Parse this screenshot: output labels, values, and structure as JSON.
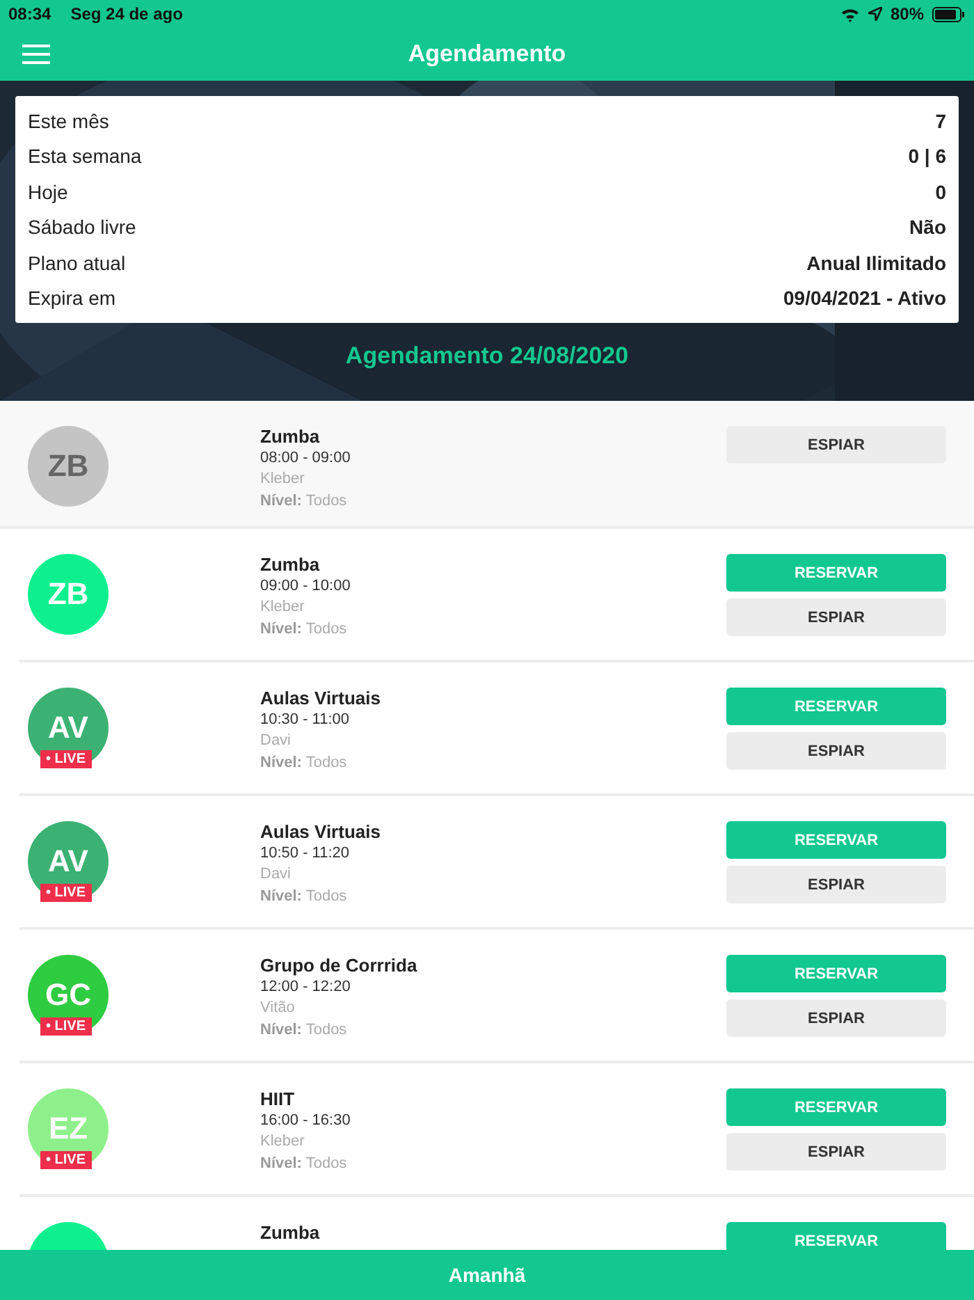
{
  "status_bar": {
    "time": "08:34",
    "date": "Seg 24 de ago",
    "battery": "80%"
  },
  "nav": {
    "title": "Agendamento"
  },
  "stats": [
    {
      "label": "Este mês",
      "value": "7"
    },
    {
      "label": "Esta semana",
      "value": "0 | 6"
    },
    {
      "label": "Hoje",
      "value": "0"
    },
    {
      "label": "Sábado livre",
      "value": "Não"
    },
    {
      "label": "Plano atual",
      "value": "Anual Ilimitado"
    },
    {
      "label": "Expira em",
      "value": "09/04/2021 - Ativo"
    }
  ],
  "heading": "Agendamento 24/08/2020",
  "classes": [
    {
      "initials": "ZB",
      "color": "#c4c4c4",
      "past": true,
      "live": false,
      "name": "Zumba",
      "time": "08:00 - 09:00",
      "instructor": "Kleber",
      "level_label": "Nível:",
      "level_value": "Todos",
      "buttons": [
        {
          "kind": "secondary",
          "label": "ESPIAR"
        }
      ]
    },
    {
      "initials": "ZB",
      "color": "#0ef08f",
      "past": false,
      "live": false,
      "name": "Zumba",
      "time": "09:00 - 10:00",
      "instructor": "Kleber",
      "level_label": "Nível:",
      "level_value": "Todos",
      "buttons": [
        {
          "kind": "primary",
          "label": "RESERVAR"
        },
        {
          "kind": "secondary",
          "label": "ESPIAR"
        }
      ]
    },
    {
      "initials": "AV",
      "color": "#3bb273",
      "past": false,
      "live": true,
      "live_label": "• LIVE",
      "name": "Aulas Virtuais",
      "time": "10:30 - 11:00",
      "instructor": "Davi",
      "level_label": "Nível:",
      "level_value": "Todos",
      "buttons": [
        {
          "kind": "primary",
          "label": "RESERVAR"
        },
        {
          "kind": "secondary",
          "label": "ESPIAR"
        }
      ]
    },
    {
      "initials": "AV",
      "color": "#3bb273",
      "past": false,
      "live": true,
      "live_label": "• LIVE",
      "name": "Aulas Virtuais",
      "time": "10:50 - 11:20",
      "instructor": "Davi",
      "level_label": "Nível:",
      "level_value": "Todos",
      "buttons": [
        {
          "kind": "primary",
          "label": "RESERVAR"
        },
        {
          "kind": "secondary",
          "label": "ESPIAR"
        }
      ]
    },
    {
      "initials": "GC",
      "color": "#2ecc40",
      "past": false,
      "live": true,
      "live_label": "• LIVE",
      "name": "Grupo de Corrrida",
      "time": "12:00 - 12:20",
      "instructor": "Vitão",
      "level_label": "Nível:",
      "level_value": "Todos",
      "buttons": [
        {
          "kind": "primary",
          "label": "RESERVAR"
        },
        {
          "kind": "secondary",
          "label": "ESPIAR"
        }
      ]
    },
    {
      "initials": "EZ",
      "color": "#8ef08a",
      "past": false,
      "live": true,
      "live_label": "• LIVE",
      "name": "HIIT",
      "time": "16:00 - 16:30",
      "instructor": "Kleber",
      "level_label": "Nível:",
      "level_value": "Todos",
      "buttons": [
        {
          "kind": "primary",
          "label": "RESERVAR"
        },
        {
          "kind": "secondary",
          "label": "ESPIAR"
        }
      ]
    },
    {
      "color": "#0ef08f",
      "past": false,
      "live": false,
      "name": "Zumba",
      "buttons": [
        {
          "kind": "primary",
          "label": "RESERVAR"
        }
      ]
    }
  ],
  "bottom_button": "Amanhã"
}
